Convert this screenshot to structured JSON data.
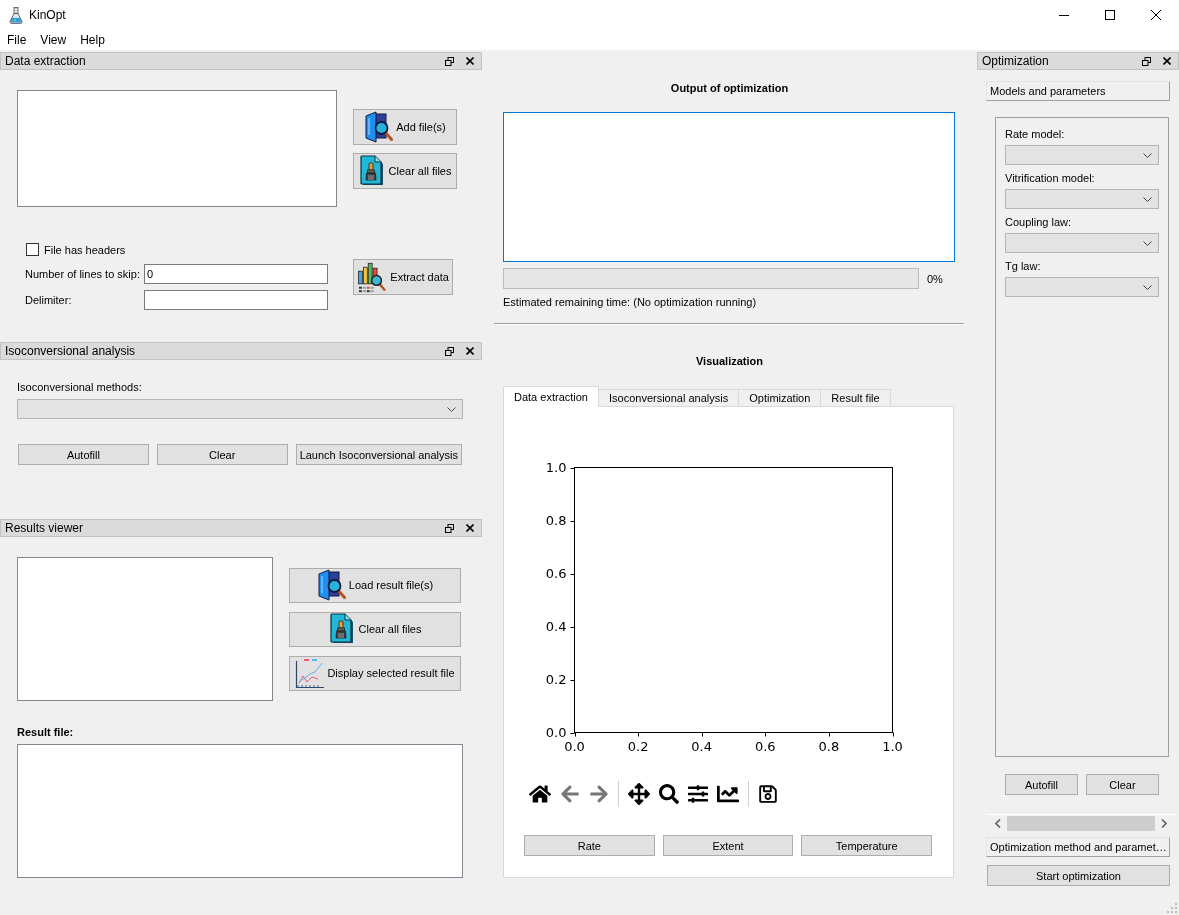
{
  "window": {
    "title": "KinOpt"
  },
  "menu": [
    {
      "label": "File"
    },
    {
      "label": "View"
    },
    {
      "label": "Help"
    }
  ],
  "data_extraction": {
    "title": "Data extraction",
    "file_buttons": [
      {
        "kind": "open",
        "label": "Add file(s)"
      },
      {
        "kind": "clear",
        "label": "Clear all files"
      }
    ],
    "has_headers": {
      "label": "File has headers",
      "checked": false
    },
    "fields": [
      {
        "label": "Number of lines to skip:",
        "value": "0"
      },
      {
        "label": "Delimiter:"
      }
    ],
    "extract_button": {
      "kind": "extract",
      "label": "Extract data"
    }
  },
  "isoconversional_analysis": {
    "title": "Isoconversional analysis",
    "methods_label": "Isoconversional methods:",
    "buttons": [
      {
        "label": "Autofill"
      },
      {
        "label": "Clear"
      },
      {
        "label": "Launch Isoconversional analysis"
      }
    ]
  },
  "results_viewer": {
    "title": "Results viewer",
    "buttons": [
      {
        "kind": "open",
        "label": "Load result file(s)"
      },
      {
        "kind": "clear",
        "label": "Clear all files"
      },
      {
        "kind": "plot",
        "label": "Display selected result file"
      }
    ],
    "result_file_label": "Result file:"
  },
  "output": {
    "title": "Output of optimization",
    "log_focused": true,
    "progress": {
      "level": 0,
      "reading": "0%"
    },
    "remaining_time": "Estimated remaining time: (No optimization running)"
  },
  "visualization": {
    "title": "Visualization",
    "tabs": [
      {
        "label": "Data extraction",
        "selected": true
      },
      {
        "label": "Isoconversional analysis",
        "selected": false
      },
      {
        "label": "Optimization",
        "selected": false
      },
      {
        "label": "Result file",
        "selected": false
      }
    ],
    "chart_data": {
      "type": "line",
      "xlim": [
        0,
        1
      ],
      "ylim": [
        0,
        1
      ],
      "xticks": [
        {
          "value": 0,
          "label": "0.0"
        },
        {
          "value": 0.2,
          "label": "0.2"
        },
        {
          "value": 0.4,
          "label": "0.4"
        },
        {
          "value": 0.6,
          "label": "0.6"
        },
        {
          "value": 0.8,
          "label": "0.8"
        },
        {
          "value": 1,
          "label": "1.0"
        }
      ],
      "yticks": [
        {
          "value": 0,
          "label": "0.0"
        },
        {
          "value": 0.2,
          "label": "0.2"
        },
        {
          "value": 0.4,
          "label": "0.4"
        },
        {
          "value": 0.6,
          "label": "0.6"
        },
        {
          "value": 0.8,
          "label": "0.8"
        },
        {
          "value": 1,
          "label": "1.0"
        }
      ]
    },
    "toolbar": {
      "back_disabled": true,
      "forward_disabled": true
    },
    "plot_buttons": [
      {
        "label": "Rate"
      },
      {
        "label": "Extent"
      },
      {
        "label": "Temperature"
      }
    ]
  },
  "optimization": {
    "title": "Optimization",
    "models_section": {
      "label": "Models and parameters",
      "fields": [
        {
          "label": "Rate model:"
        },
        {
          "label": "Vitrification model:"
        },
        {
          "label": "Coupling law:"
        },
        {
          "label": "Tg law:"
        }
      ],
      "buttons": [
        {
          "label": "Autofill"
        },
        {
          "label": "Clear"
        }
      ]
    },
    "method_section": {
      "label": "Optimization method and paramet…"
    },
    "start_button": {
      "label": "Start optimization"
    }
  }
}
